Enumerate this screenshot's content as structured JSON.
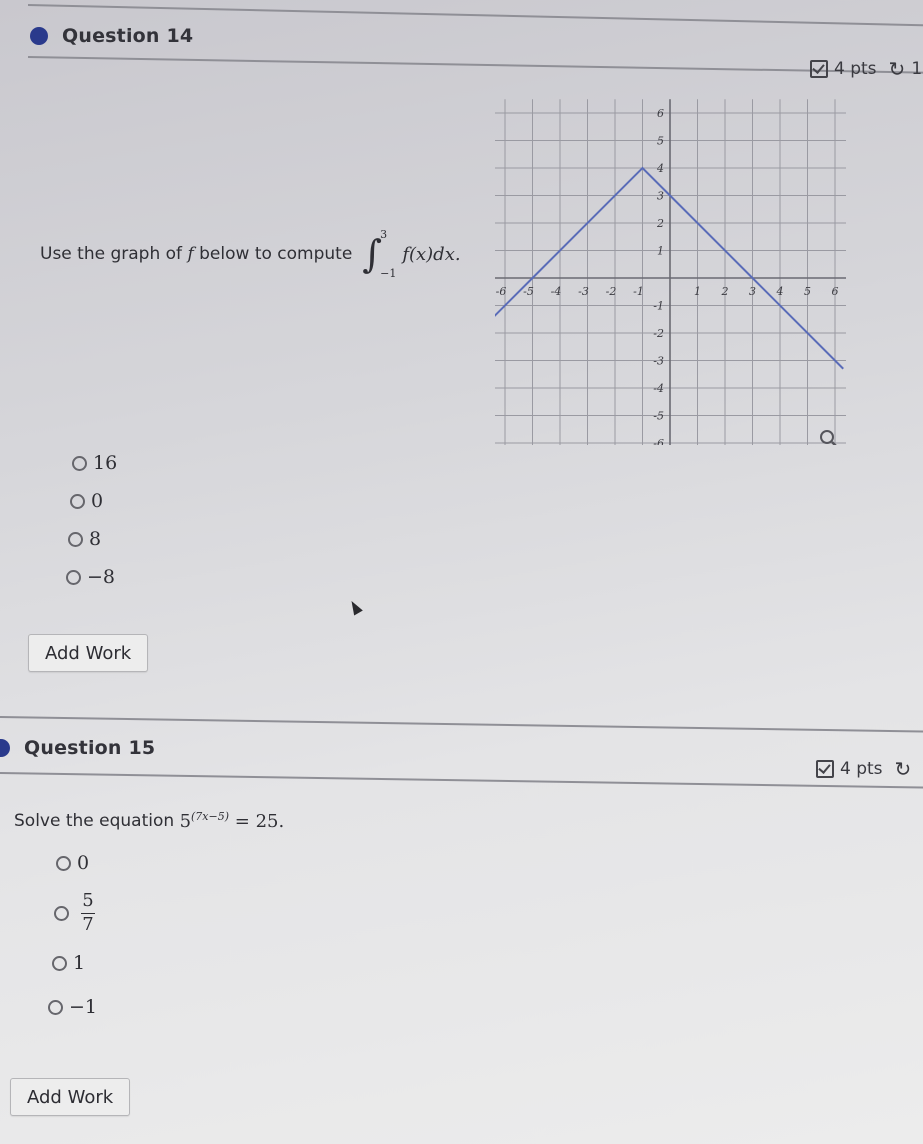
{
  "questions": [
    {
      "title": "Question 14",
      "points": "4 pts",
      "points_suffix": "1",
      "prompt_prefix": "Use the graph of",
      "prompt_fn": "f",
      "prompt_mid": "below to compute",
      "integral": {
        "lower": "−1",
        "upper": "3",
        "integrand": "f(x)dx."
      },
      "options": [
        "16",
        "0",
        "8",
        "−8"
      ],
      "add_work_label": "Add Work"
    },
    {
      "title": "Question 15",
      "points": "4 pts",
      "prompt_prefix": "Solve the equation",
      "equation": {
        "base": "5",
        "exponent": "(7x−5)",
        "rhs": "= 25."
      },
      "options": [
        "0",
        "5/7",
        "1",
        "−1"
      ],
      "fraction_option": {
        "numerator": "5",
        "denominator": "7"
      },
      "add_work_label": "Add Work"
    }
  ],
  "icons": {
    "points_check": "checkbox-edit-icon",
    "redo": "redo-icon",
    "zoom": "magnifier-icon"
  },
  "colors": {
    "accent_dot": "#2a3a8c",
    "graph_line": "#5a6cb8"
  },
  "chart_data": {
    "type": "line",
    "title": "",
    "xlabel": "",
    "ylabel": "",
    "xlim": [
      -6,
      6
    ],
    "ylim": [
      -6,
      6
    ],
    "grid": true,
    "x_ticks": [
      "-6",
      "-5",
      "-4",
      "-3",
      "-2",
      "-1",
      "1",
      "2",
      "3",
      "4",
      "5",
      "6"
    ],
    "y_ticks": [
      "6",
      "5",
      "4",
      "3",
      "2",
      "1",
      "-1",
      "-2",
      "-3",
      "-4",
      "-5",
      "-6"
    ],
    "series": [
      {
        "name": "f",
        "points": [
          [
            -6.4,
            -1.4
          ],
          [
            -5,
            0
          ],
          [
            -1,
            4
          ],
          [
            0,
            3
          ],
          [
            3,
            0
          ],
          [
            6.3,
            -3.3
          ]
        ]
      }
    ]
  }
}
